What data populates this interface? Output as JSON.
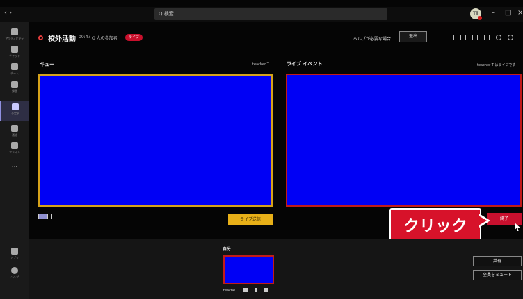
{
  "titlebar": {
    "nav_arrows": "‹  ›",
    "search_placeholder": "Q 検索",
    "avatar_initials": "TT",
    "minimize": "–",
    "maximize": "□",
    "close": "×"
  },
  "rail": {
    "items": [
      {
        "label": "アクティビティ"
      },
      {
        "label": "チャット"
      },
      {
        "label": "チーム"
      },
      {
        "label": "課題"
      },
      {
        "label": "予定表"
      },
      {
        "label": "通話"
      },
      {
        "label": "ファイル"
      },
      {
        "label": "..."
      },
      {
        "label": "アプリ"
      },
      {
        "label": "ヘルプ"
      }
    ]
  },
  "meeting": {
    "title": "校外活動",
    "timer": "00:47",
    "attendees": "0 人の参加者",
    "live_badge": "ライブ",
    "help_link": "ヘルプが必要な場合",
    "leave_button": "退出"
  },
  "queue": {
    "label": "キュー",
    "presenter": "teacher T",
    "send_live_button": "ライブ送信"
  },
  "live": {
    "label": "ライブ イベント",
    "status": "teacher T はライブです",
    "end_button": "終了"
  },
  "callout": {
    "text": "クリック"
  },
  "self": {
    "label": "自分",
    "name": "teache..."
  },
  "actions": {
    "share_button": "共有",
    "mute_all_button": "全員をミュート"
  },
  "colors": {
    "accent_live": "#c8102e",
    "send_live": "#e8b018",
    "video_blue": "#0000f5",
    "queue_border": "#d5a21a"
  }
}
